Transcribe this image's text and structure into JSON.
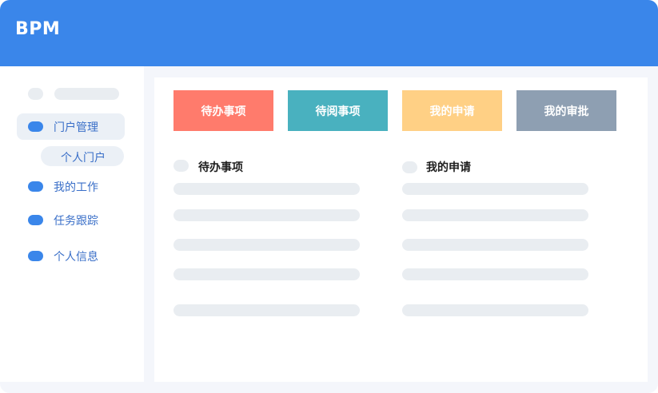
{
  "header": {
    "brand": "BPM",
    "background_color": "#3a86ea"
  },
  "sidebar": {
    "items": [
      {
        "label": "门户管理",
        "icon": "menu-dot-icon",
        "active": true
      },
      {
        "label": "个人门户",
        "icon": null,
        "sub": true
      },
      {
        "label": "我的工作",
        "icon": "menu-dot-icon"
      },
      {
        "label": "任务跟踪",
        "icon": "menu-dot-icon"
      },
      {
        "label": "个人信息",
        "icon": "menu-dot-icon"
      }
    ]
  },
  "tiles": [
    {
      "label": "待办事项",
      "color": "#ff7b6c"
    },
    {
      "label": "待阅事项",
      "color": "#49b1bf"
    },
    {
      "label": "我的申请",
      "color": "#ffd085"
    },
    {
      "label": "我的审批",
      "color": "#8e9fb2"
    }
  ],
  "lists": [
    {
      "title": "待办事项",
      "row_count": 5
    },
    {
      "title": "我的申请",
      "row_count": 5
    }
  ]
}
